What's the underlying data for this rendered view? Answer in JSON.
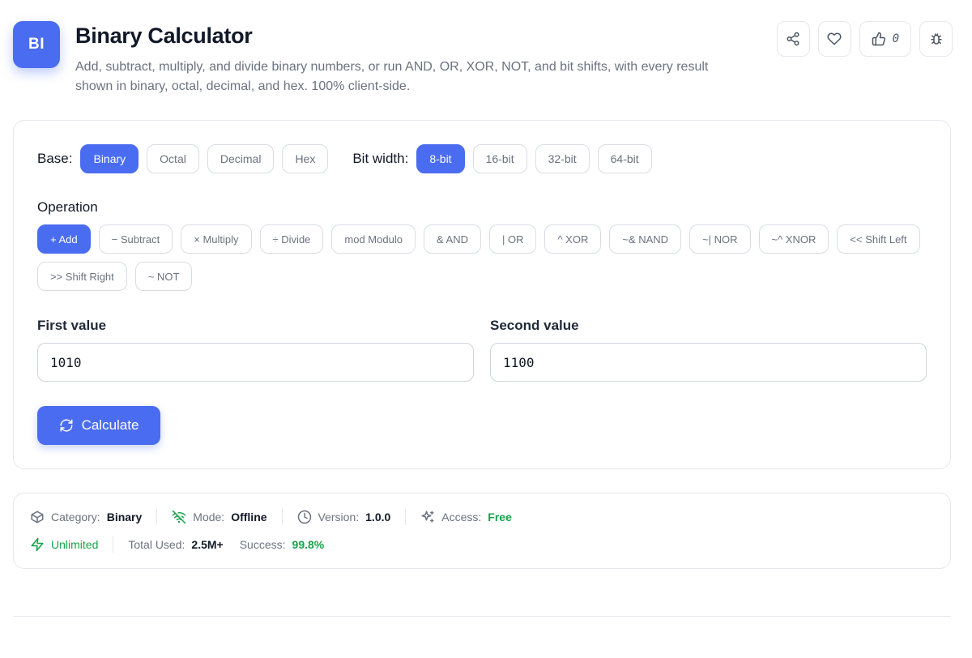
{
  "header": {
    "logo_text": "BI",
    "title": "Binary Calculator",
    "description": "Add, subtract, multiply, and divide binary numbers, or run AND, OR, XOR, NOT, and bit shifts, with every result shown in binary, octal, decimal, and hex. 100% client-side.",
    "like_count": "0",
    "actions": [
      "share-icon",
      "heart-icon",
      "thumbs-up-icon",
      "bug-icon"
    ]
  },
  "base": {
    "label": "Base:",
    "options": [
      "Binary",
      "Octal",
      "Decimal",
      "Hex"
    ],
    "selected": "Binary"
  },
  "bit_width": {
    "label": "Bit width:",
    "options": [
      "8-bit",
      "16-bit",
      "32-bit",
      "64-bit"
    ],
    "selected": "8-bit"
  },
  "operation": {
    "label": "Operation",
    "options": [
      "+ Add",
      "− Subtract",
      "× Multiply",
      "÷ Divide",
      "mod Modulo",
      "& AND",
      "| OR",
      "^ XOR",
      "~& NAND",
      "~| NOR",
      "~^ XNOR",
      "<< Shift Left",
      ">> Shift Right",
      "~ NOT"
    ],
    "selected": "+ Add"
  },
  "inputs": {
    "first_label": "First value",
    "first_value": "1010",
    "second_label": "Second value",
    "second_value": "1100"
  },
  "calculate": {
    "label": "Calculate",
    "icon": "refresh-icon"
  },
  "meta": {
    "category_label": "Category:",
    "category_value": "Binary",
    "mode_label": "Mode:",
    "mode_value": "Offline",
    "version_label": "Version:",
    "version_value": "1.0.0",
    "access_label": "Access:",
    "access_value": "Free",
    "unlimited": "Unlimited",
    "total_used_label": "Total Used:",
    "total_used_value": "2.5M+",
    "success_label": "Success:",
    "success_value": "99.8%"
  },
  "colors": {
    "accent": "#4a6cf0",
    "success": "#16a34a",
    "border": "#e5e7eb",
    "muted_text": "#6b7280"
  }
}
